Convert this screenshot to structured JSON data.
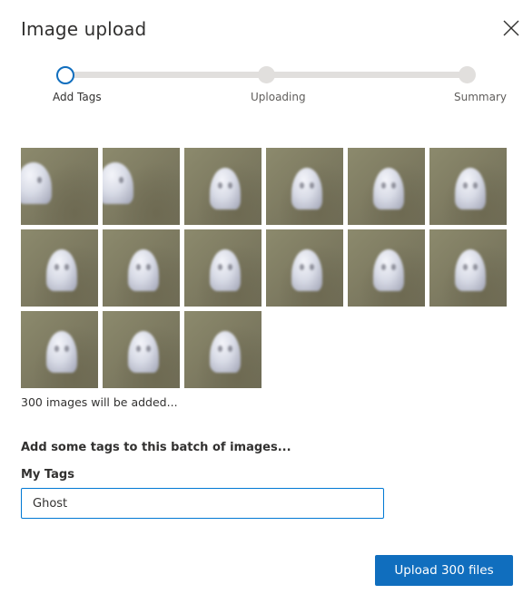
{
  "dialog": {
    "title": "Image upload",
    "close_icon": "close-icon"
  },
  "stepper": {
    "steps": [
      {
        "label": "Add Tags",
        "state": "active"
      },
      {
        "label": "Uploading",
        "state": "upcoming"
      },
      {
        "label": "Summary",
        "state": "upcoming"
      }
    ],
    "active_color": "#106ebe",
    "track_color": "#e1dfdd"
  },
  "thumbnails": {
    "count_shown": 15,
    "subject": "ghost figurine photo",
    "summary": "300 images will be added..."
  },
  "tags": {
    "prompt": "Add some tags to this batch of images...",
    "label": "My Tags",
    "value": "Ghost",
    "placeholder": ""
  },
  "actions": {
    "upload_label": "Upload 300 files",
    "upload_color": "#106ebe"
  }
}
